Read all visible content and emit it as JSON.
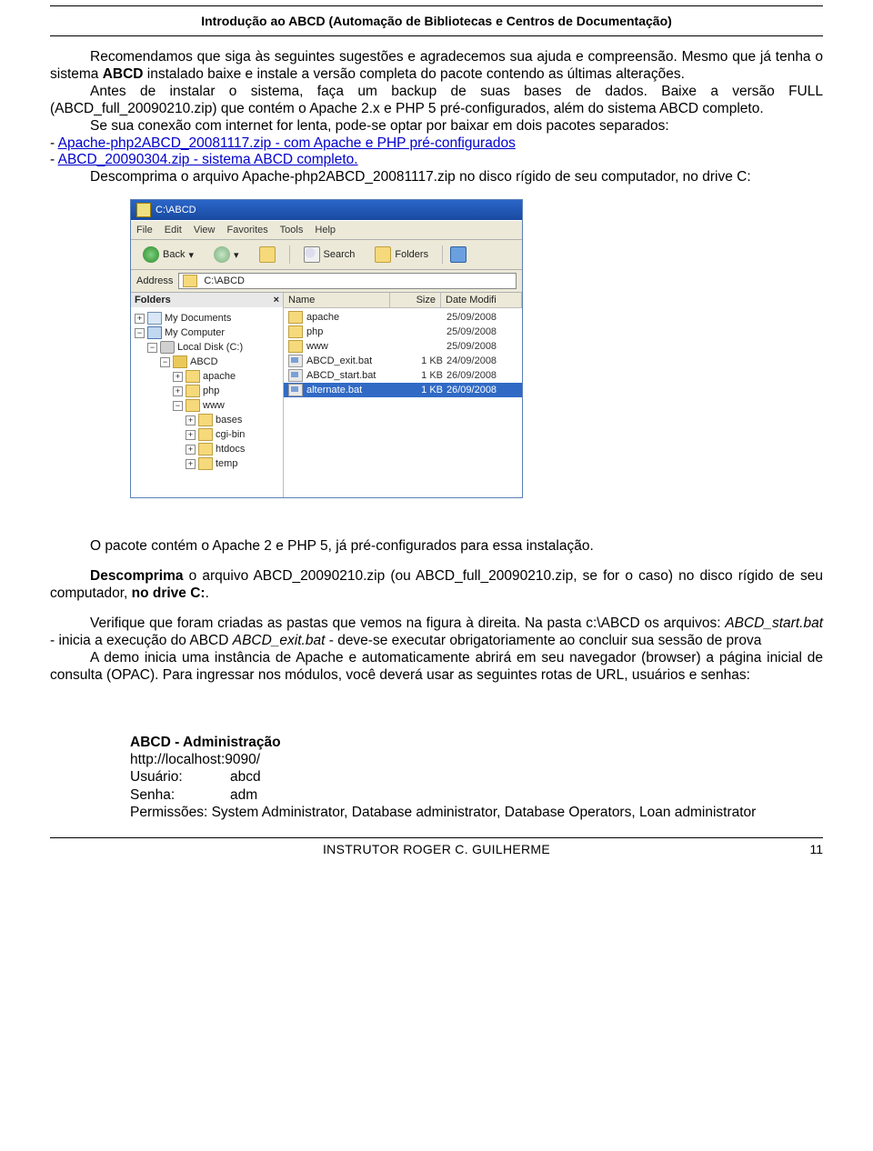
{
  "header": {
    "title": "Introdução ao ABCD (Automação de Bibliotecas e Centros de Documentação)"
  },
  "text": {
    "p1a": "Recomendamos que siga às seguintes sugestões e agradecemos sua ajuda e compreensão. Mesmo que já tenha o sistema ",
    "p1b": "ABCD",
    "p1c": " instalado baixe e instale a versão completa do pacote contendo as últimas alterações.",
    "p2": "Antes de instalar o sistema, faça um backup de suas bases de dados. Baixe a versão FULL (ABCD_full_20090210.zip) que contém o Apache 2.x e PHP 5 pré-configurados, além do sistema ABCD completo.",
    "p3": "Se sua conexão com internet for lenta, pode-se optar por baixar em dois pacotes separados:",
    "link1_prefix": "- ",
    "link1": "Apache-php2ABCD_20081117.zip - com Apache e PHP pré-configurados",
    "link2_prefix": "- ",
    "link2": "ABCD_20090304.zip - sistema ABCD completo.",
    "p4a": "Descomprima o arquivo Apache-php2ABCD_20081117.zip no disco rígido de seu computador, no drive C:",
    "p5": "O pacote contém o Apache 2 e PHP 5, já pré-configurados para essa instalação.",
    "p6a": "Descomprima",
    "p6b": " o arquivo ABCD_20090210.zip (ou ABCD_full_20090210.zip, se for o caso) no disco rígido de seu computador, ",
    "p6c": "no drive C:",
    "p6d": ".",
    "p7a": "Verifique que foram criadas as pastas que vemos na figura à direita. Na pasta c:\\ABCD os arquivos: ",
    "p7b": "ABCD_start.bat",
    "p7c": " - inicia a execução do ABCD ",
    "p7d": "ABCD_exit.bat",
    "p7e": " - deve-se executar obrigatoriamente ao concluir sua sessão de prova",
    "p8": "A demo inicia uma instância de Apache e automaticamente abrirá em seu navegador (browser) a página inicial de consulta (OPAC). Para ingressar nos módulos, você deverá usar as seguintes rotas de URL, usuários e senhas:"
  },
  "explorer": {
    "title": "C:\\ABCD",
    "menu": [
      "File",
      "Edit",
      "View",
      "Favorites",
      "Tools",
      "Help"
    ],
    "toolbar": {
      "back": "Back",
      "search": "Search",
      "folders": "Folders"
    },
    "address_label": "Address",
    "address_value": "C:\\ABCD",
    "folders_label": "Folders",
    "tree": {
      "mydocs": "My Documents",
      "mycomp": "My Computer",
      "localdisk": "Local Disk (C:)",
      "abcd": "ABCD",
      "apache": "apache",
      "php": "php",
      "www": "www",
      "bases": "bases",
      "cgibin": "cgi-bin",
      "htdocs": "htdocs",
      "temp": "temp"
    },
    "list_headers": {
      "name": "Name",
      "size": "Size",
      "date": "Date Modifi"
    },
    "rows": [
      {
        "name": "apache",
        "size": "",
        "date": "25/09/2008",
        "type": "folder"
      },
      {
        "name": "php",
        "size": "",
        "date": "25/09/2008",
        "type": "folder"
      },
      {
        "name": "www",
        "size": "",
        "date": "25/09/2008",
        "type": "folder"
      },
      {
        "name": "ABCD_exit.bat",
        "size": "1 KB",
        "date": "24/09/2008",
        "type": "bat"
      },
      {
        "name": "ABCD_start.bat",
        "size": "1 KB",
        "date": "26/09/2008",
        "type": "bat"
      },
      {
        "name": "alternate.bat",
        "size": "1 KB",
        "date": "26/09/2008",
        "type": "bat",
        "selected": true
      }
    ]
  },
  "admin": {
    "title": "ABCD - Administração",
    "url": "http://localhost:9090/",
    "user_label": "Usuário:",
    "user_value": "abcd",
    "pass_label": "Senha:",
    "pass_value": "adm",
    "perms": "Permissões: System Administrator, Database administrator, Database Operators, Loan administrator"
  },
  "footer": {
    "instructor": "INSTRUTOR ROGER C. GUILHERME",
    "page": "11"
  }
}
